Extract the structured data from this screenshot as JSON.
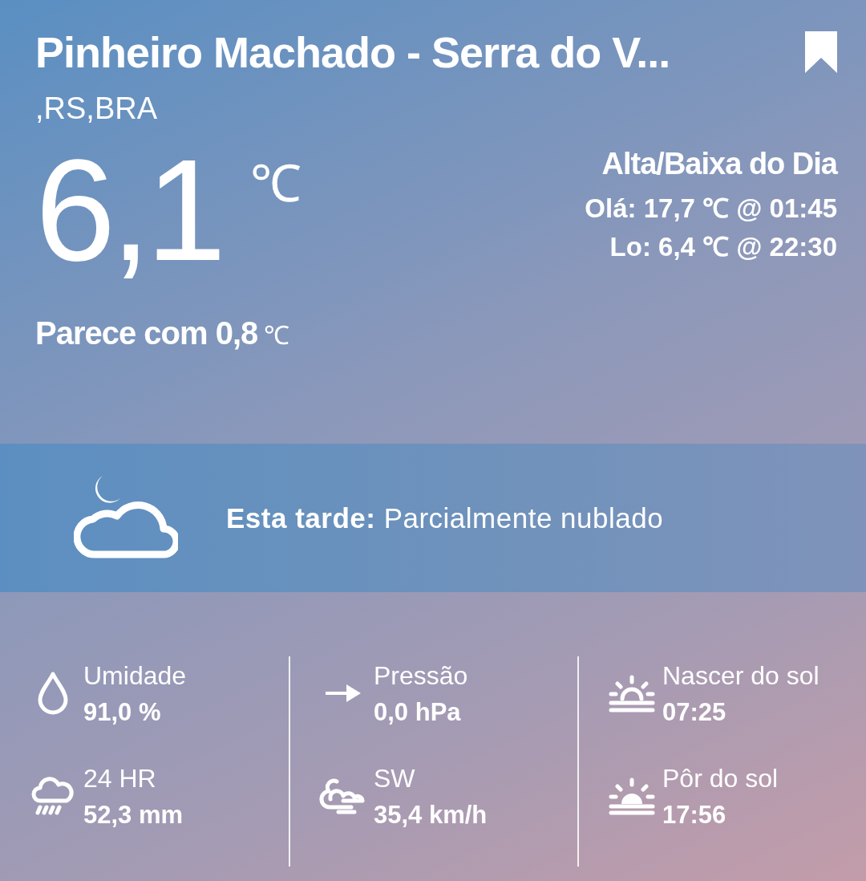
{
  "header": {
    "title": "Pinheiro Machado - Serra do V...",
    "subtitle": ",RS,BRA"
  },
  "current": {
    "temperature": "6,1",
    "unit": "℃",
    "feels_like_label": "Parece com",
    "feels_like_value": "0,8",
    "feels_like_unit": "℃"
  },
  "day_range": {
    "title": "Alta/Baixa do Dia",
    "lines": [
      "Olá: 17,7 ℃ @ 01:45",
      "Lo: 6,4 ℃ @ 22:30"
    ]
  },
  "forecast": {
    "text": "**Esta tarde:** Parcialmente nublado"
  },
  "stats": [
    [
      {
        "kind": "humidity",
        "label": "Umidade",
        "value": "91,0 %"
      },
      {
        "kind": "rain",
        "label": "24 HR",
        "value": "52,3 mm"
      }
    ],
    [
      {
        "kind": "pressure",
        "label": "Pressão",
        "value": "0,0 hPa"
      },
      {
        "kind": "wind",
        "label": "SW",
        "value": "35,4 km/h"
      }
    ],
    [
      {
        "kind": "sunrise",
        "label": "Nascer do sol",
        "value": "07:25"
      },
      {
        "kind": "sunset",
        "label": "Pôr do sol",
        "value": "17:56"
      }
    ]
  ]
}
